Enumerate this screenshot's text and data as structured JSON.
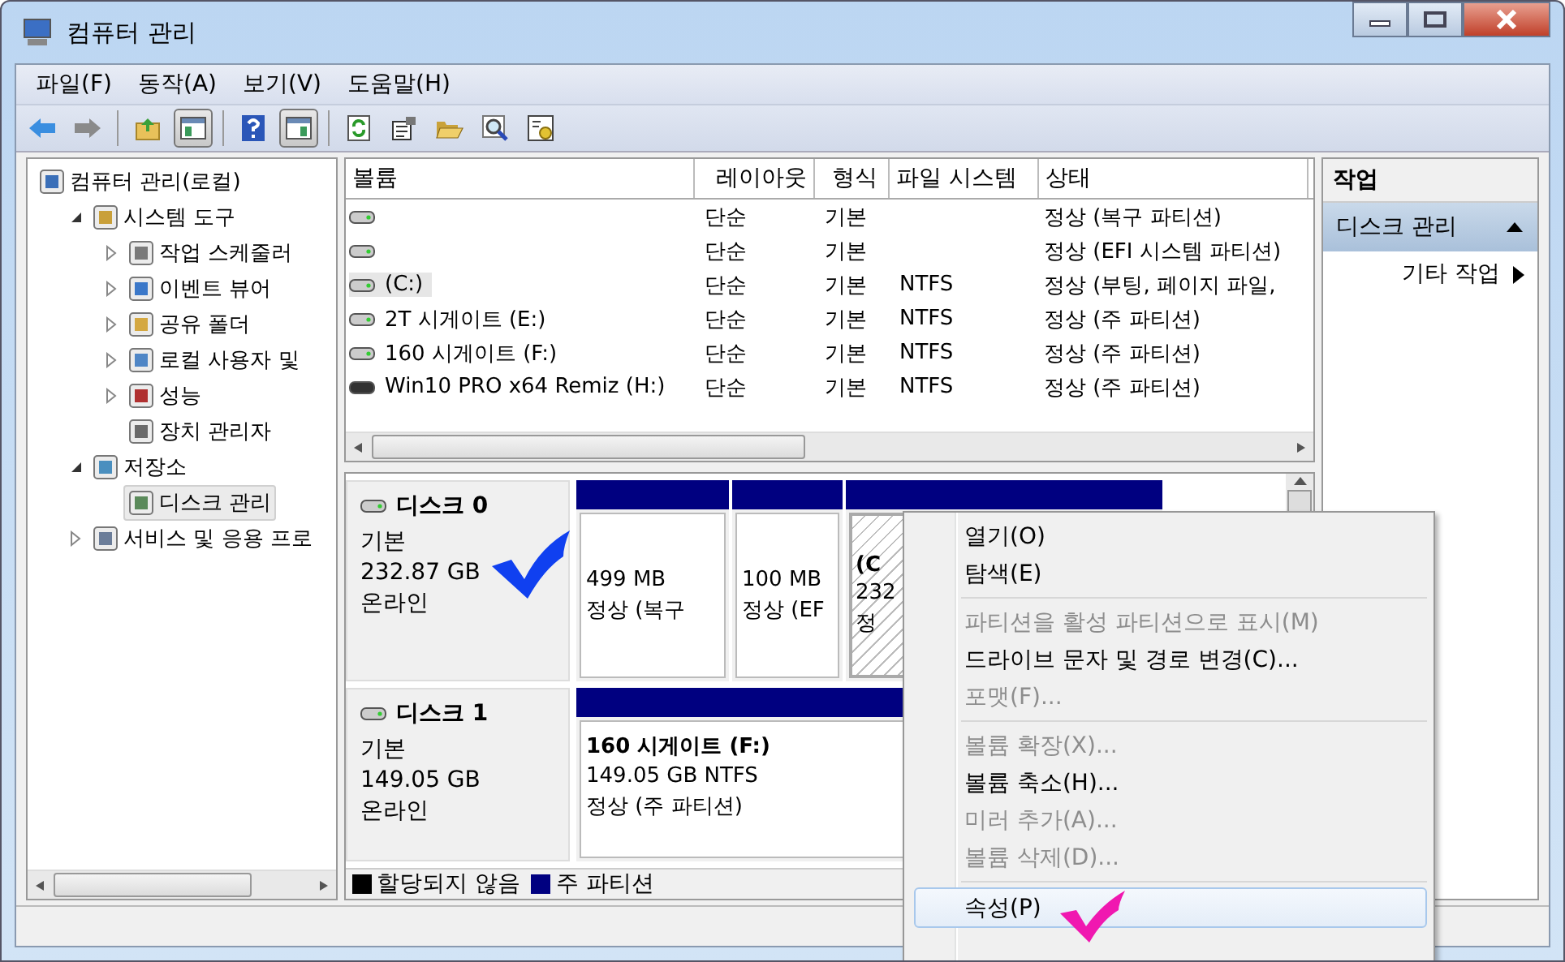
{
  "window": {
    "title": "컴퓨터 관리"
  },
  "menu": [
    "파일(F)",
    "동작(A)",
    "보기(V)",
    "도움말(H)"
  ],
  "toolbar": [
    {
      "kind": "back",
      "on": false
    },
    {
      "kind": "forward",
      "on": false
    },
    {
      "kind": "up",
      "on": false
    },
    {
      "kind": "tree",
      "on": true
    },
    {
      "kind": "help",
      "on": false
    },
    {
      "kind": "pane",
      "on": true
    },
    {
      "kind": "refresh",
      "on": false
    },
    {
      "kind": "properties",
      "on": false
    },
    {
      "kind": "open",
      "on": false
    },
    {
      "kind": "search",
      "on": false
    },
    {
      "kind": "settings",
      "on": false
    }
  ],
  "tree": [
    {
      "label": "컴퓨터 관리(로컬)",
      "selected": false,
      "children": [
        {
          "label": "시스템 도구",
          "kind": "folder",
          "expanded": true,
          "selected": false,
          "children": [
            {
              "label": "작업 스케줄러",
              "kind": "folder",
              "expanded": false,
              "selected": false
            },
            {
              "label": "이벤트 뷰어",
              "kind": "folder",
              "expanded": false,
              "selected": false
            },
            {
              "label": "공유 폴더",
              "kind": "folder",
              "expanded": false,
              "selected": false
            },
            {
              "label": "로컬 사용자 및",
              "kind": "folder",
              "expanded": false,
              "selected": false
            },
            {
              "label": "성능",
              "kind": "folder",
              "expanded": false,
              "selected": false
            },
            {
              "label": "장치 관리자",
              "kind": "leaf",
              "selected": false
            }
          ]
        },
        {
          "label": "저장소",
          "kind": "folder",
          "expanded": true,
          "selected": false,
          "children": [
            {
              "label": "디스크 관리",
              "kind": "leaf",
              "selected": true
            }
          ]
        },
        {
          "label": "서비스 및 응용 프로",
          "kind": "folder",
          "expanded": false,
          "selected": false
        }
      ]
    }
  ],
  "volumes": {
    "columns": [
      "볼륨",
      "레이아웃",
      "형식",
      "파일 시스템",
      "상태"
    ],
    "rows": [
      {
        "kind": "disk",
        "layout": "단순",
        "type": "기본",
        "status": "정상 (복구 파티션)",
        "selected": false
      },
      {
        "kind": "disk",
        "layout": "단순",
        "type": "기본",
        "status": "정상 (EFI 시스템 파티션)",
        "selected": false
      },
      {
        "kind": "disk",
        "name": "(C:)",
        "layout": "단순",
        "type": "기본",
        "fs": "NTFS",
        "status": "정상 (부팅, 페이지 파일,",
        "selected": true
      },
      {
        "kind": "disk",
        "name": "2T 시게이트 (E:)",
        "layout": "단순",
        "type": "기본",
        "fs": "NTFS",
        "status": "정상 (주 파티션)",
        "selected": false
      },
      {
        "kind": "disk",
        "name": "160 시게이트  (F:)",
        "layout": "단순",
        "type": "기본",
        "fs": "NTFS",
        "status": "정상 (주 파티션)",
        "selected": false
      },
      {
        "kind": "removable",
        "name": "Win10 PRO x64 Remiz (H:)",
        "layout": "단순",
        "type": "기본",
        "fs": "NTFS",
        "status": "정상 (주 파티션)",
        "selected": false
      }
    ]
  },
  "disks": [
    {
      "name": "디스크 0",
      "type": "기본",
      "size": "232.87 GB",
      "status": "온라인",
      "partitions": [
        {
          "size": "499 MB",
          "status": "정상 (복구",
          "selected": false
        },
        {
          "size": "100 MB",
          "status": "정상 (EF",
          "selected": false
        },
        {
          "label": "(C",
          "size": "232",
          "status": "정",
          "selected": true
        }
      ]
    },
    {
      "name": "디스크 1",
      "type": "기본",
      "size": "149.05 GB",
      "status": "온라인",
      "partitions": [
        {
          "label": "160 시게이트   (F:)",
          "size": "149.05 GB NTFS",
          "status": "정상 (주 파티션)",
          "selected": false
        }
      ]
    }
  ],
  "legend": [
    {
      "label": "할당되지 않음",
      "color": "#000000"
    },
    {
      "label": "주 파티션",
      "color": "#000080"
    }
  ],
  "actions": {
    "title": "작업",
    "section": {
      "label": "디스크 관리",
      "expanded": true
    },
    "items": [
      "기타 작업"
    ]
  },
  "context_menu": [
    {
      "kind": "item",
      "label": "열기(O)",
      "disabled": false,
      "selected": false
    },
    {
      "kind": "item",
      "label": "탐색(E)",
      "disabled": false,
      "selected": false
    },
    {
      "kind": "separator"
    },
    {
      "kind": "item",
      "label": "파티션을 활성 파티션으로 표시(M)",
      "disabled": true,
      "selected": false
    },
    {
      "kind": "item",
      "label": "드라이브 문자 및 경로 변경(C)...",
      "disabled": false,
      "selected": false
    },
    {
      "kind": "item",
      "label": "포맷(F)...",
      "disabled": true,
      "selected": false
    },
    {
      "kind": "separator"
    },
    {
      "kind": "item",
      "label": "볼륨 확장(X)...",
      "disabled": true,
      "selected": false
    },
    {
      "kind": "item",
      "label": "볼륨 축소(H)...",
      "disabled": false,
      "selected": false
    },
    {
      "kind": "item",
      "label": "미러 추가(A)...",
      "disabled": true,
      "selected": false
    },
    {
      "kind": "item",
      "label": "볼륨 삭제(D)...",
      "disabled": true,
      "selected": false
    },
    {
      "kind": "separator"
    },
    {
      "kind": "item",
      "label": "속성(P)",
      "disabled": false,
      "selected": true
    }
  ]
}
